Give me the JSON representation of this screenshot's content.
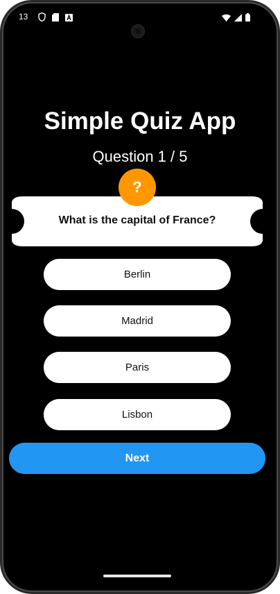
{
  "status_bar": {
    "time": "13",
    "left_icons": [
      "shield-icon",
      "sd-card-icon",
      "font-icon"
    ],
    "right_icons": [
      "wifi-icon",
      "signal-icon",
      "battery-icon"
    ]
  },
  "app": {
    "title": "Simple Quiz App",
    "question_counter": "Question 1 / 5",
    "badge_symbol": "?",
    "question": "What is the capital of France?",
    "answers": [
      {
        "label": "Berlin"
      },
      {
        "label": "Madrid"
      },
      {
        "label": "Paris"
      },
      {
        "label": "Lisbon"
      }
    ],
    "next_label": "Next"
  },
  "colors": {
    "background": "#000000",
    "card": "#ffffff",
    "badge": "#ff9800",
    "next_button": "#2196f3"
  }
}
